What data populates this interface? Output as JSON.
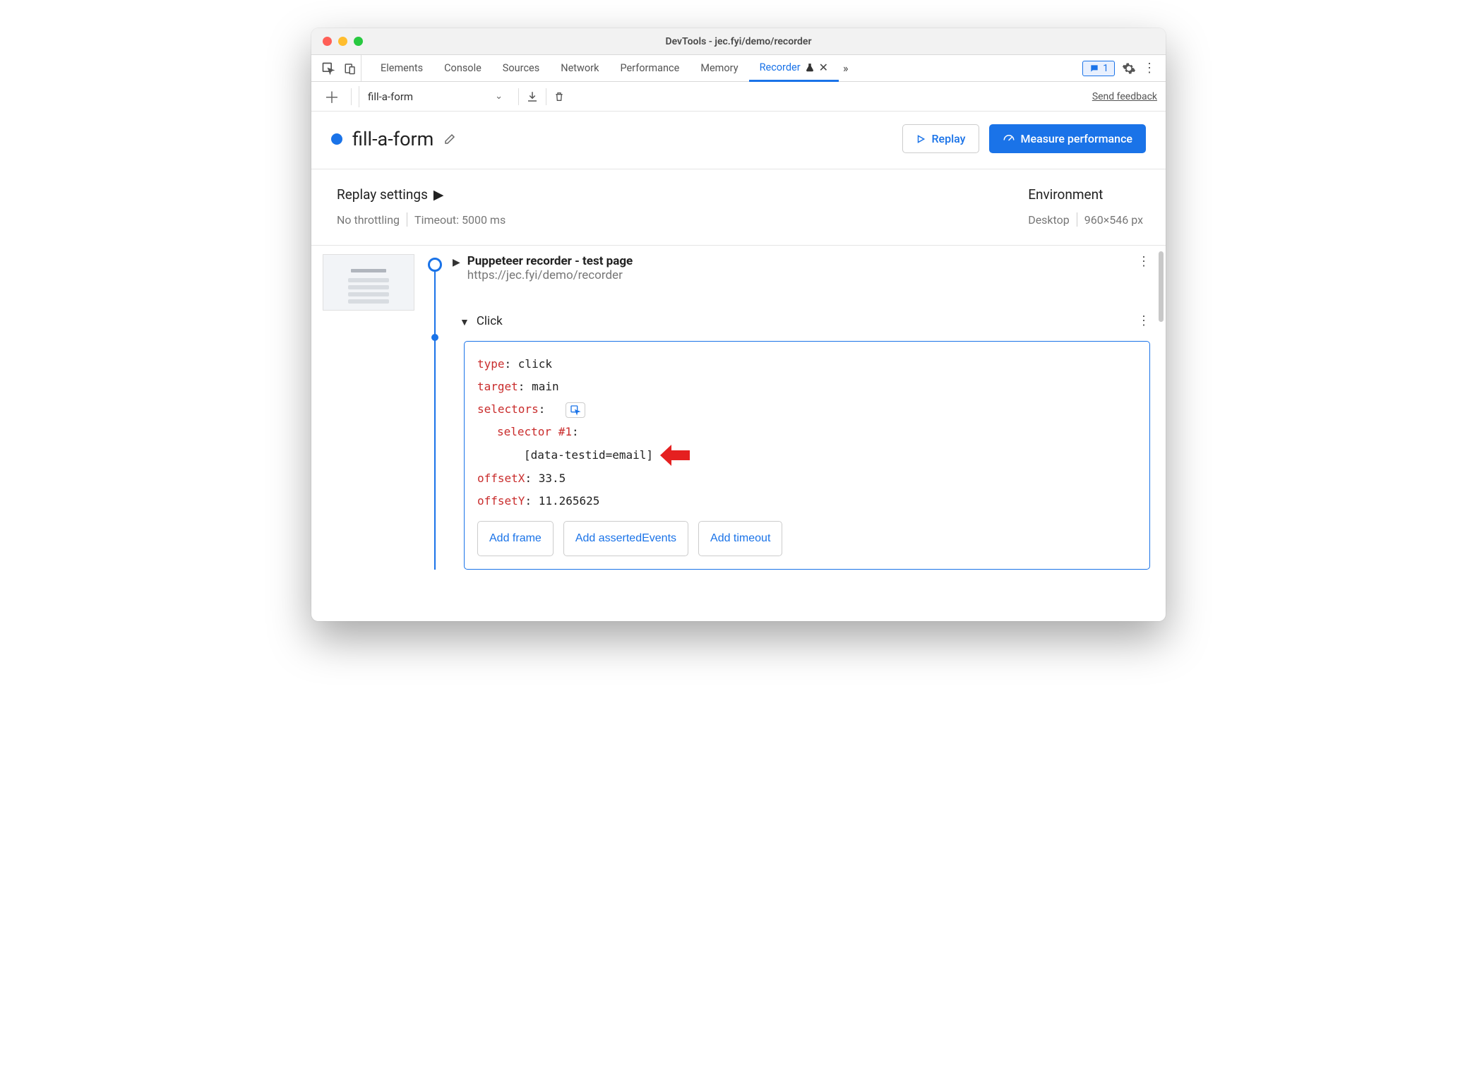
{
  "window": {
    "title": "DevTools - jec.fyi/demo/recorder"
  },
  "tabs": {
    "items": [
      "Elements",
      "Console",
      "Sources",
      "Network",
      "Performance",
      "Memory"
    ],
    "active": "Recorder",
    "message_count": "1"
  },
  "toolbar": {
    "recording_name": "fill-a-form",
    "feedback": "Send feedback"
  },
  "header": {
    "title": "fill-a-form",
    "replay_label": "Replay",
    "measure_label": "Measure performance"
  },
  "settings": {
    "replay_heading": "Replay settings",
    "throttling": "No throttling",
    "timeout": "Timeout: 5000 ms",
    "env_heading": "Environment",
    "device": "Desktop",
    "viewport": "960×546 px"
  },
  "steps": {
    "s1_title": "Puppeteer recorder - test page",
    "s1_url": "https://jec.fyi/demo/recorder",
    "s2_title": "Click",
    "details": {
      "type_key": "type",
      "type_val": ": click",
      "target_key": "target",
      "target_val": ": main",
      "selectors_key": "selectors",
      "selectors_colon": ":",
      "selector1_key": "selector #1",
      "selector1_colon": ":",
      "selector1_val": "[data-testid=email]",
      "offsetX_key": "offsetX",
      "offsetX_val": ": 33.5",
      "offsetY_key": "offsetY",
      "offsetY_val": ": 11.265625"
    },
    "add_frame": "Add frame",
    "add_asserted": "Add assertedEvents",
    "add_timeout": "Add timeout"
  }
}
